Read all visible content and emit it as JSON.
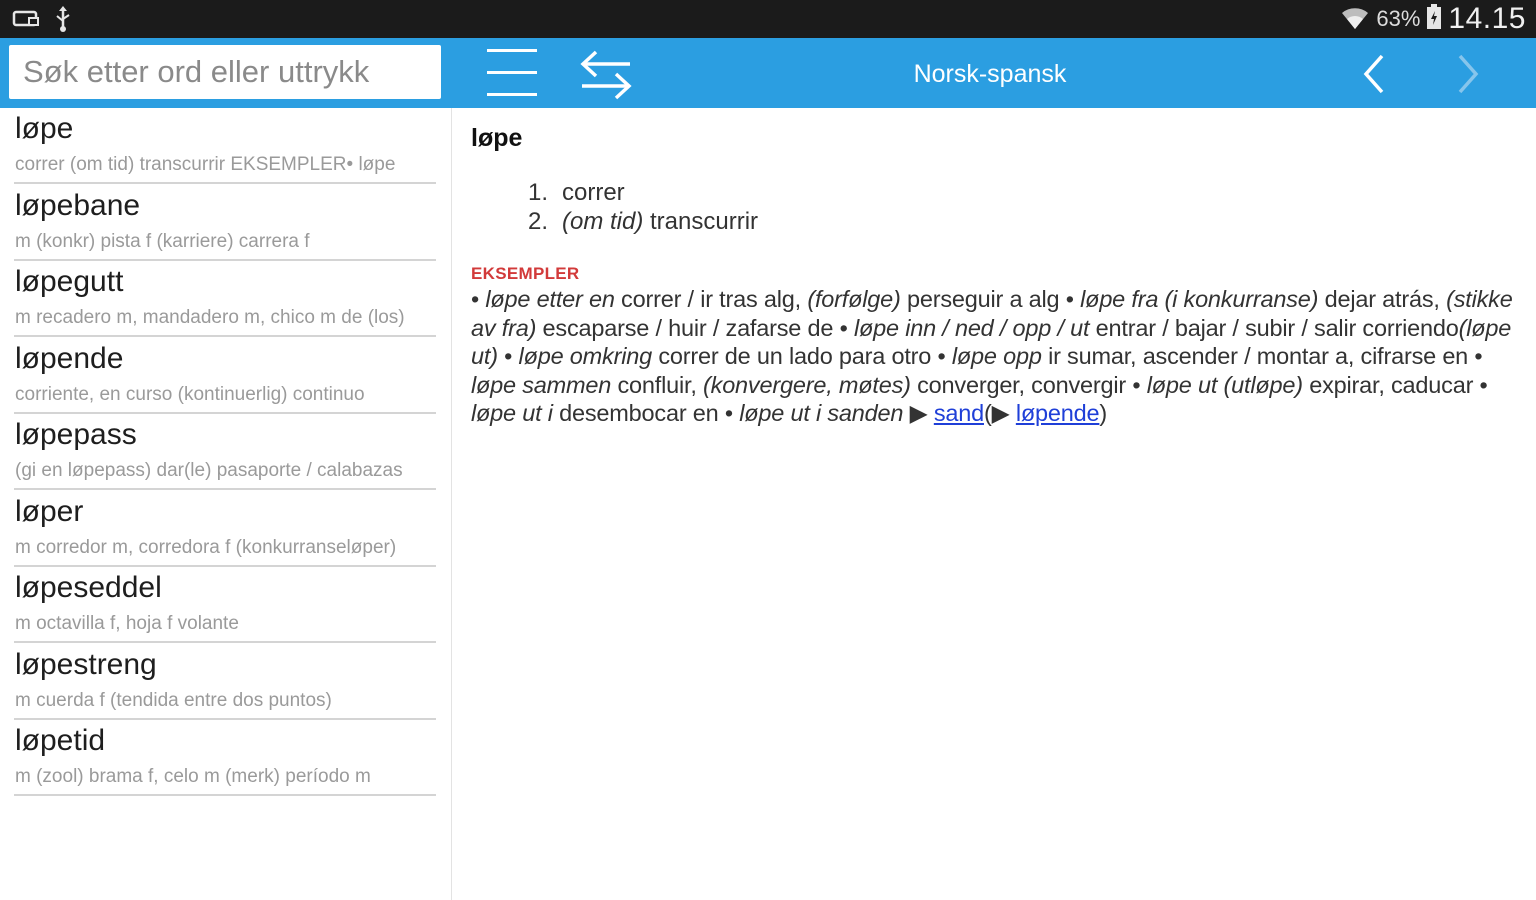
{
  "status_bar": {
    "battery_percent": "63%",
    "time": "14.15",
    "icons": [
      "screen-mirror-icon",
      "usb-icon",
      "wifi-icon",
      "battery-icon"
    ]
  },
  "toolbar": {
    "search_placeholder": "Søk etter ord eller uttrykk",
    "search_value": "",
    "title": "Norsk-spansk",
    "icons": [
      "hamburger-menu-icon",
      "swap-direction-icon",
      "chevron-left-icon",
      "chevron-right-icon"
    ],
    "accent_color": "#2b9ee1"
  },
  "word_list": [
    {
      "headword": "løpe",
      "summary": "correr (om tid) transcurrir EKSEMPLER• løpe"
    },
    {
      "headword": "løpebane",
      "summary": "m (konkr) pista f (karriere) carrera f"
    },
    {
      "headword": "løpegutt",
      "summary": "m recadero m, mandadero m, chico m de (los)"
    },
    {
      "headword": "løpende",
      "summary": "corriente, en curso (kontinuerlig) continuo"
    },
    {
      "headword": "løpepass",
      "summary": "(gi en løpepass) dar(le) pasaporte / calabazas"
    },
    {
      "headword": "løper",
      "summary": "m corredor m, corredora f (konkurranseløper)"
    },
    {
      "headword": "løpeseddel",
      "summary": "m octavilla f, hoja f volante"
    },
    {
      "headword": "løpestreng",
      "summary": "m cuerda f (tendida entre dos puntos)"
    },
    {
      "headword": "løpetid",
      "summary": "m (zool) brama f, celo m (merk) período m"
    }
  ],
  "entry": {
    "headword": "løpe",
    "senses": [
      {
        "num": "1.",
        "label": "",
        "text": "correr"
      },
      {
        "num": "2.",
        "label": "(om tid)",
        "text": " transcurrir"
      }
    ],
    "examples_label": "EKSEMPLER",
    "examples": {
      "bullet": "•",
      "e1_it": "løpe etter en",
      "e1_t": " correr / ir tras alg, ",
      "e2_it": "(forfølge)",
      "e2_t": " perseguir a alg ",
      "e3_it": "løpe fra (i konkurranse)",
      "e3_t": " dejar atrás, ",
      "e4_it": "(stikke av fra)",
      "e4_t": " escaparse / huir / zafarse de ",
      "e5_it": "løpe inn / ned / opp / ut",
      "e5_t": " entrar / bajar / subir / salir corriendo",
      "e6_it": "(løpe ut)",
      "e7_it": "løpe omkring",
      "e7_t": " correr de un lado para otro ",
      "e8_it": "løpe opp",
      "e8_t": " ir sumar, ascender / montar a, cifrarse en ",
      "e9_it": "løpe sammen",
      "e9_t": " confluir, ",
      "e10_it": "(konvergere, møtes)",
      "e10_t": " converger, convergir ",
      "e11_it": "løpe ut (utløpe)",
      "e11_t": " expirar, caducar ",
      "e12_it": "løpe ut i",
      "e12_t": " desembocar en ",
      "e13_it": "løpe ut i sanden",
      "e13_t": " ",
      "arrow": "▶",
      "link1": "sand",
      "open_paren": "(",
      "link2": "løpende",
      "close_paren": ")"
    }
  }
}
